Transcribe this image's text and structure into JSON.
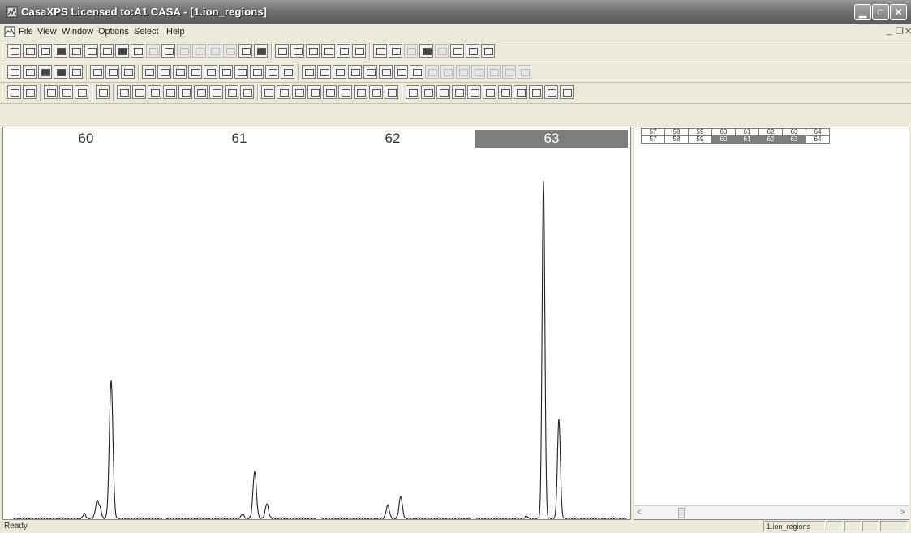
{
  "window": {
    "title": "CasaXPS Licensed to:A1 CASA - [1.ion_regions]",
    "minimize_glyph": "▁",
    "maximize_glyph": "□",
    "close_glyph": "✕"
  },
  "menu": {
    "items": [
      "File",
      "View",
      "Window",
      "Options",
      "Select",
      "Help"
    ],
    "mdi_minimize": "_",
    "mdi_restore": "❐",
    "mdi_close": "✕"
  },
  "spectra": {
    "labels": [
      "60",
      "61",
      "62",
      "63"
    ],
    "selected_index": 3,
    "line_color": "#222222"
  },
  "region_table": {
    "row1": [
      "57",
      "58",
      "59",
      "60",
      "61",
      "62",
      "63",
      "64"
    ],
    "row2": [
      "57",
      "58",
      "59",
      "60",
      "61",
      "62",
      "63",
      "64"
    ]
  },
  "scrollbar": {
    "left_arrow": "<",
    "right_arrow": ">"
  },
  "status": {
    "text": "Ready",
    "panel": "1.ion_regions"
  },
  "colors": {
    "selection": "#7d7d7d",
    "titlebar": "#6f6f6f"
  }
}
